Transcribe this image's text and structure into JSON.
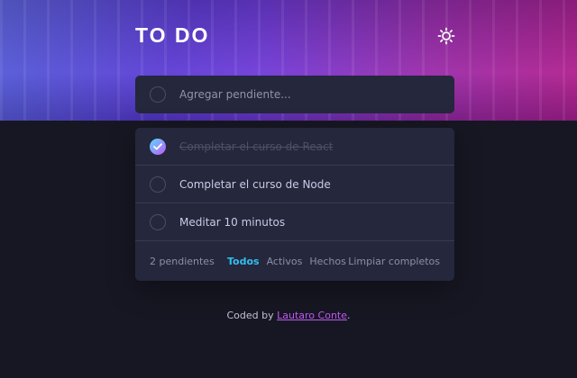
{
  "header": {
    "title": "TO DO",
    "theme_icon": "sun-icon"
  },
  "new_todo": {
    "placeholder": "Agregar pendiente..."
  },
  "todos": [
    {
      "text": "Completar el curso de React",
      "completed": true
    },
    {
      "text": "Completar el curso de Node",
      "completed": false
    },
    {
      "text": "Meditar 10 minutos",
      "completed": false
    }
  ],
  "footer": {
    "count_label": "2 pendientes",
    "filters": [
      "Todos",
      "Activos",
      "Hechos"
    ],
    "active_filter": "Todos",
    "clear_label": "Limpiar completos"
  },
  "attribution": {
    "prefix": "Coded by ",
    "author": "Lautaro Conte",
    "suffix": "."
  },
  "colors": {
    "background": "#161722",
    "card": "#25273c",
    "check_gradient_start": "#57ddff",
    "check_gradient_end": "#c058f3",
    "active_filter": "#30c0ee",
    "author_link": "#c058f3"
  }
}
